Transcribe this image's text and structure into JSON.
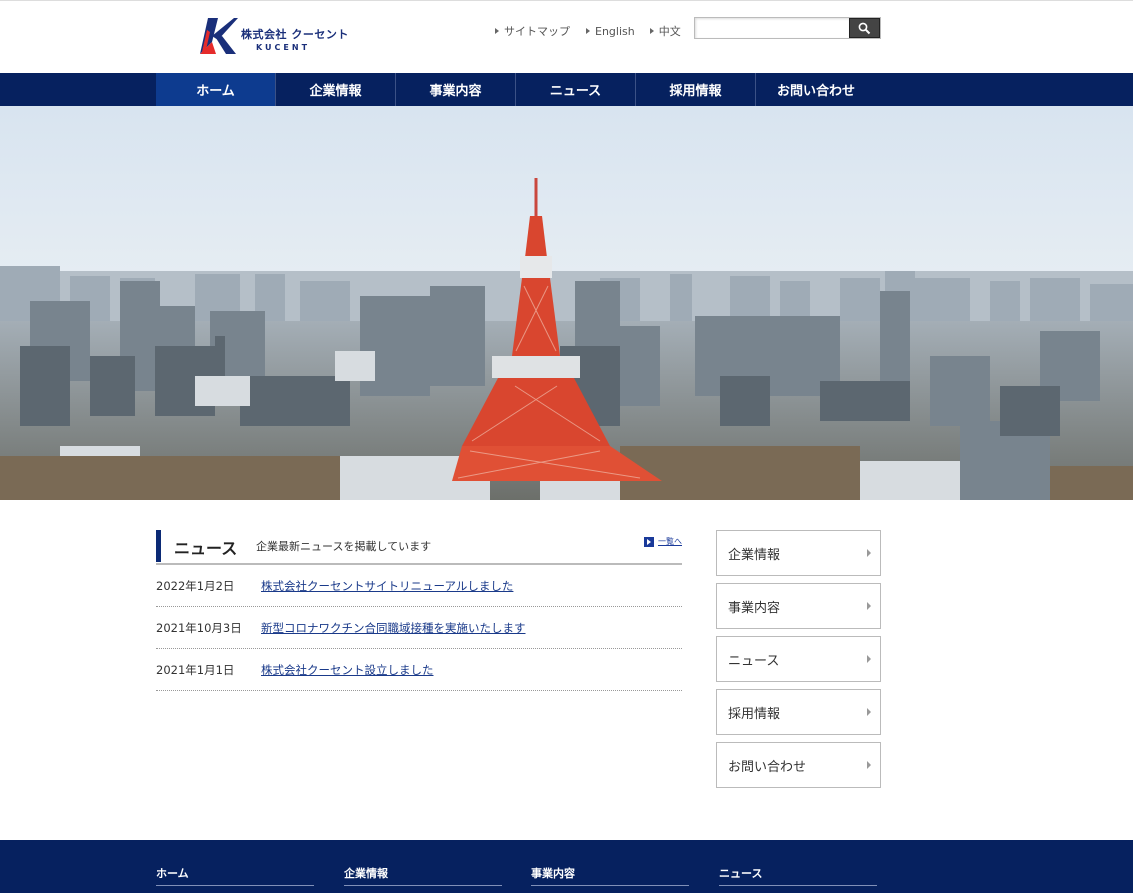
{
  "header": {
    "logo": {
      "name": "株式会社 クーセント",
      "sub": "KUCENT"
    },
    "utility": [
      {
        "label": "サイトマップ"
      },
      {
        "label": "English"
      },
      {
        "label": "中文"
      }
    ],
    "search": {
      "value": "",
      "placeholder": ""
    }
  },
  "gnav": {
    "items": [
      {
        "label": "ホーム",
        "active": true
      },
      {
        "label": "企業情報"
      },
      {
        "label": "事業内容"
      },
      {
        "label": "ニュース"
      },
      {
        "label": "採用情報"
      },
      {
        "label": "お問い合わせ"
      }
    ]
  },
  "news": {
    "title": "ニュース",
    "description": "企業最新ニュースを掲載しています",
    "more_label": "一覧へ",
    "items": [
      {
        "date": "2022年1月2日",
        "title": "株式会社クーセントサイトリニューアルしました"
      },
      {
        "date": "2021年10月3日",
        "title": "新型コロナワクチン合同職域接種を実施いたします"
      },
      {
        "date": "2021年1月1日",
        "title": "株式会社クーセント設立しました"
      }
    ]
  },
  "side_menu": {
    "items": [
      {
        "label": "企業情報"
      },
      {
        "label": "事業内容"
      },
      {
        "label": "ニュース"
      },
      {
        "label": "採用情報"
      },
      {
        "label": "お問い合わせ"
      }
    ]
  },
  "footer": {
    "columns": [
      {
        "label": "ホーム"
      },
      {
        "label": "企業情報"
      },
      {
        "label": "事業内容"
      },
      {
        "label": "ニュース"
      }
    ]
  },
  "colors": {
    "nav_bg": "#06215f",
    "nav_active": "#0d3b8f",
    "link": "#1a3a8a",
    "logo_red": "#e52b2b",
    "logo_blue": "#1a2f7a"
  }
}
